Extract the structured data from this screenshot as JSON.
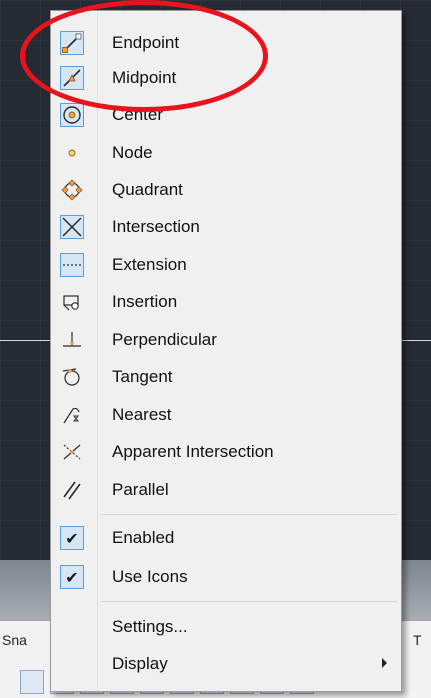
{
  "menu": {
    "items": [
      {
        "label": "Endpoint",
        "icon": "endpoint-icon"
      },
      {
        "label": "Midpoint",
        "icon": "midpoint-icon"
      },
      {
        "label": "Center",
        "icon": "center-icon"
      },
      {
        "label": "Node",
        "icon": "node-icon"
      },
      {
        "label": "Quadrant",
        "icon": "quadrant-icon"
      },
      {
        "label": "Intersection",
        "icon": "intersection-icon"
      },
      {
        "label": "Extension",
        "icon": "extension-icon"
      },
      {
        "label": "Insertion",
        "icon": "insertion-icon"
      },
      {
        "label": "Perpendicular",
        "icon": "perpendicular-icon"
      },
      {
        "label": "Tangent",
        "icon": "tangent-icon"
      },
      {
        "label": "Nearest",
        "icon": "nearest-icon"
      },
      {
        "label": "Apparent Intersection",
        "icon": "apparent-intersection-icon"
      },
      {
        "label": "Parallel",
        "icon": "parallel-icon"
      }
    ],
    "toggles": [
      {
        "label": "Enabled",
        "checked": true
      },
      {
        "label": "Use Icons",
        "checked": true
      }
    ],
    "settings_label": "Settings...",
    "display_label": "Display"
  },
  "statusbar": {
    "snap_label": "Sna",
    "t_label": "T"
  },
  "colors": {
    "highlight_border": "#56a0e0",
    "highlight_fill": "#d5e6f7",
    "annotation": "#e8131c",
    "osnap_icon_fill": "#e08a2e"
  }
}
